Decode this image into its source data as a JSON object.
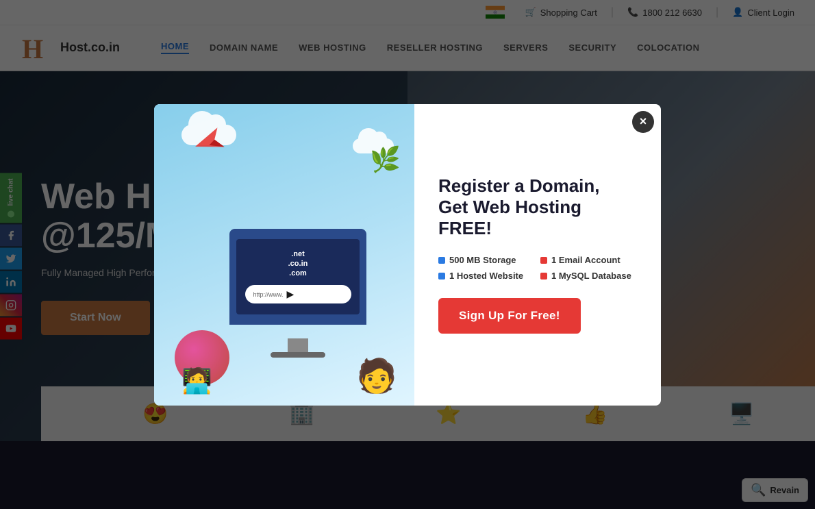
{
  "topbar": {
    "cart_label": "Shopping Cart",
    "phone_label": "1800 212 6630",
    "login_label": "Client Login"
  },
  "nav": {
    "home": "HOME",
    "domain": "DOMAIN NAME",
    "webhosting": "WEB HOSTING",
    "reseller": "RESELLER HOSTING",
    "servers": "SERVERS",
    "security": "SECURITY",
    "colocation": "COLOCATION",
    "logo_text": "Host.co.in"
  },
  "hero": {
    "title_line1": "Web H",
    "title_line2": "@125/M",
    "subtitle": "Fully Managed High Performance Hosting With Free Dom...",
    "cta_label": "Start Now"
  },
  "modal": {
    "title": "Register a Domain,",
    "subtitle": "Get Web Hosting",
    "subtitle_strong": "FREE!",
    "features": [
      {
        "label": "500 MB Storage",
        "color": "blue"
      },
      {
        "label": "1 Email Account",
        "color": "red"
      },
      {
        "label": "1 Hosted Website",
        "color": "blue"
      },
      {
        "label": "1 MySQL Database",
        "color": "red"
      }
    ],
    "signup_label": "Sign Up For Free!",
    "close_label": "×",
    "url_placeholder": "http://www."
  },
  "social": {
    "live_chat": "live chat",
    "facebook": "f",
    "twitter": "t",
    "linkedin": "in",
    "instagram": "ig",
    "youtube": "yt"
  },
  "revain": {
    "label": "Revain"
  }
}
